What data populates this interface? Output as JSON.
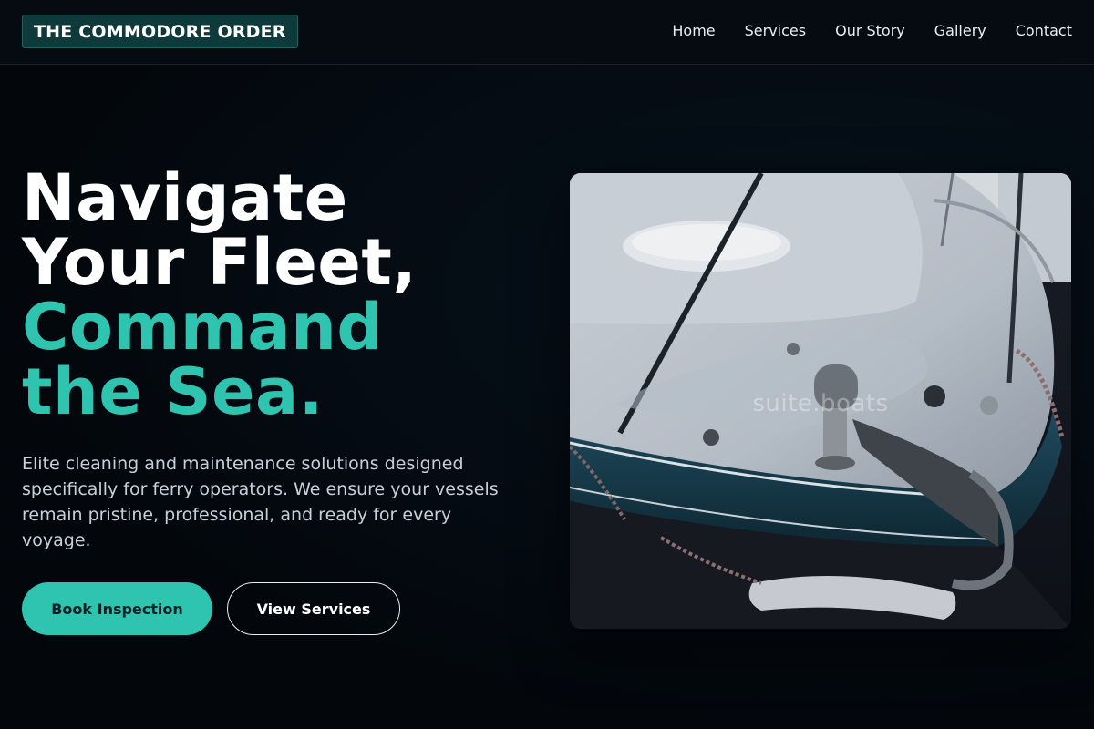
{
  "brand": {
    "name": "THE COMMODORE ORDER"
  },
  "nav": {
    "links": [
      "Home",
      "Services",
      "Our Story",
      "Gallery",
      "Contact"
    ]
  },
  "hero": {
    "title_line1": "Navigate",
    "title_line2": "Your Fleet,",
    "title_line3": "Command",
    "title_line4": "the Sea.",
    "description": "Elite cleaning and maintenance solutions designed specifically for ferry operators. We ensure your vessels remain pristine, professional, and ready for every voyage.",
    "primary_button": "Book Inspection",
    "secondary_button": "View Services",
    "image_watermark": "suite.boats"
  },
  "colors": {
    "background": "#050a10",
    "accent": "#2ec4b0",
    "brand_badge": "#0f3a3c"
  }
}
